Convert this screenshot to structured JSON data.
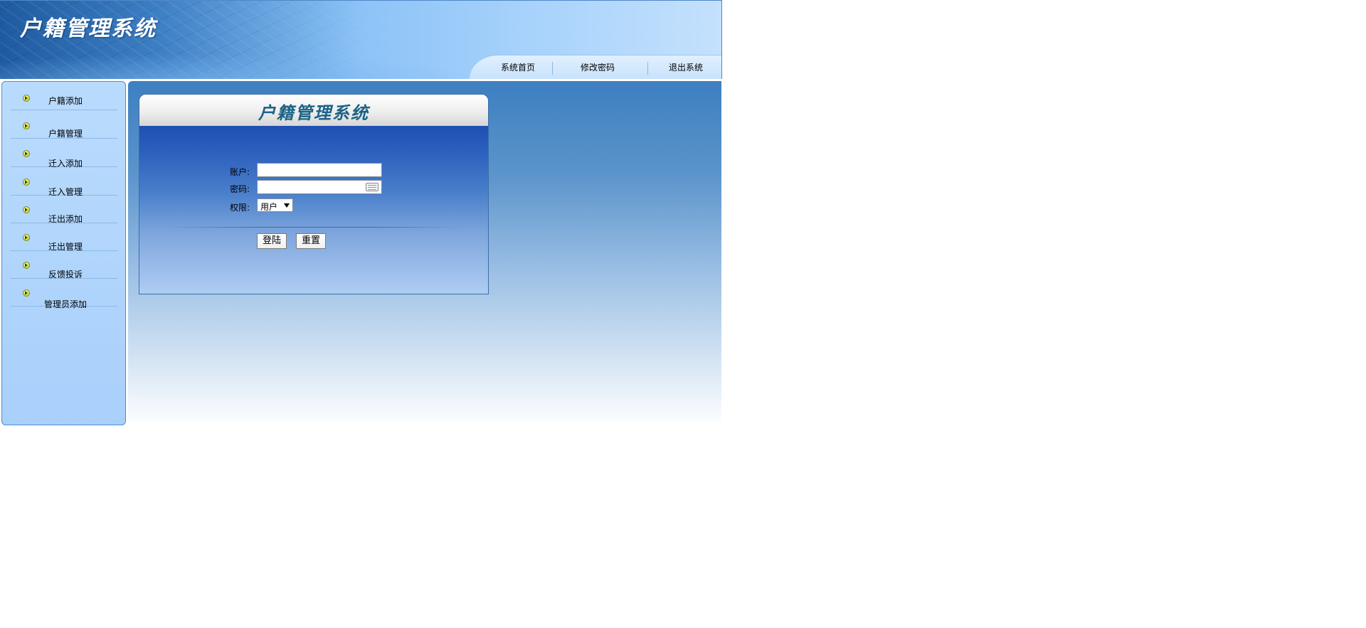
{
  "app": {
    "title": "户籍管理系统"
  },
  "top_nav": {
    "items": [
      {
        "label": "系统首页"
      },
      {
        "label": "修改密码"
      },
      {
        "label": "退出系统"
      }
    ]
  },
  "sidebar": {
    "items": [
      {
        "label": "户籍添加",
        "icon": "arrow-bullet-icon"
      },
      {
        "label": "户籍管理",
        "icon": "arrow-bullet-icon"
      },
      {
        "label": "迁入添加",
        "icon": "arrow-bullet-icon"
      },
      {
        "label": "迁入管理",
        "icon": "arrow-bullet-icon"
      },
      {
        "label": "迁出添加",
        "icon": "arrow-bullet-icon"
      },
      {
        "label": "迁出管理",
        "icon": "arrow-bullet-icon"
      },
      {
        "label": "反馈投诉",
        "icon": "arrow-bullet-icon"
      },
      {
        "label": "管理员添加",
        "icon": "arrow-bullet-icon"
      }
    ]
  },
  "login": {
    "title": "户籍管理系统",
    "account_label": "账户:",
    "account_value": "",
    "password_label": "密码:",
    "password_value": "",
    "password_icon": "keyboard-icon",
    "role_label": "权限:",
    "role_selected": "用户",
    "login_button": "登陆",
    "reset_button": "重置"
  },
  "colors": {
    "header_dark": "#1e5aa0",
    "header_light": "#c4e1fd",
    "sidebar_bg": "#b9dbfd",
    "login_title": "#1c6286",
    "login_body_top": "#1e4fb3"
  }
}
